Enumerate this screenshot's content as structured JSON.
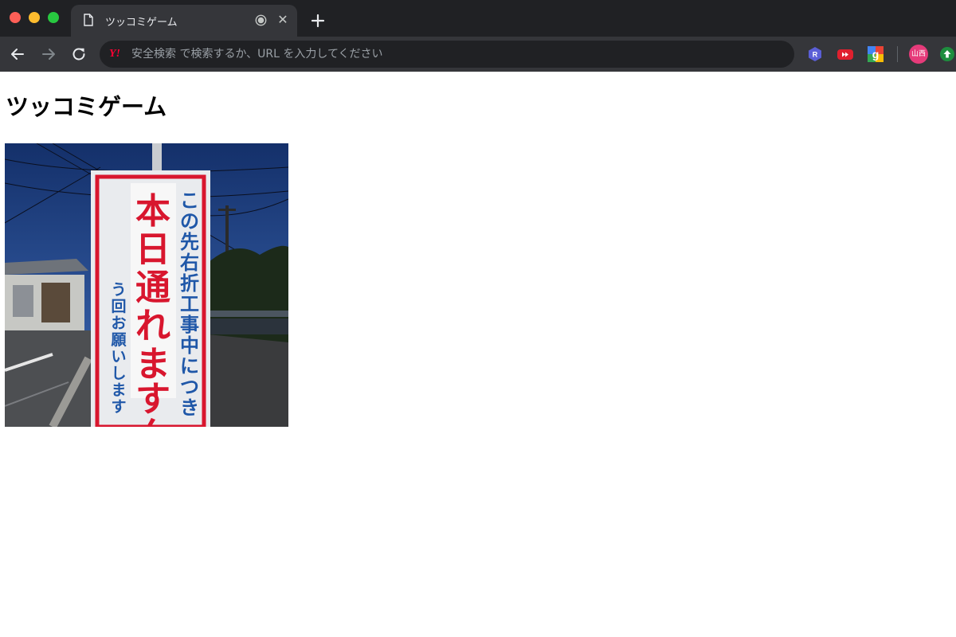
{
  "browser": {
    "tab_title": "ツッコミゲーム",
    "omnibox": {
      "provider_logo": "Y!",
      "placeholder": "安全検索 で検索するか、URL を入力してください"
    },
    "profile_label": "山西",
    "extensions": [
      "r-extension-icon",
      "youtube-extension-icon",
      "google-extension-icon",
      "upload-extension-icon"
    ]
  },
  "page": {
    "title": "ツッコミゲーム",
    "image": {
      "sign_main": "本日通れますん",
      "sign_right": "この先右折工事中につき",
      "sign_left": "う回お願いします"
    }
  },
  "colors": {
    "chrome_dark": "#202124",
    "chrome_tab": "#35363a",
    "sign_red": "#d8162e",
    "sign_blue": "#1f57a8"
  }
}
